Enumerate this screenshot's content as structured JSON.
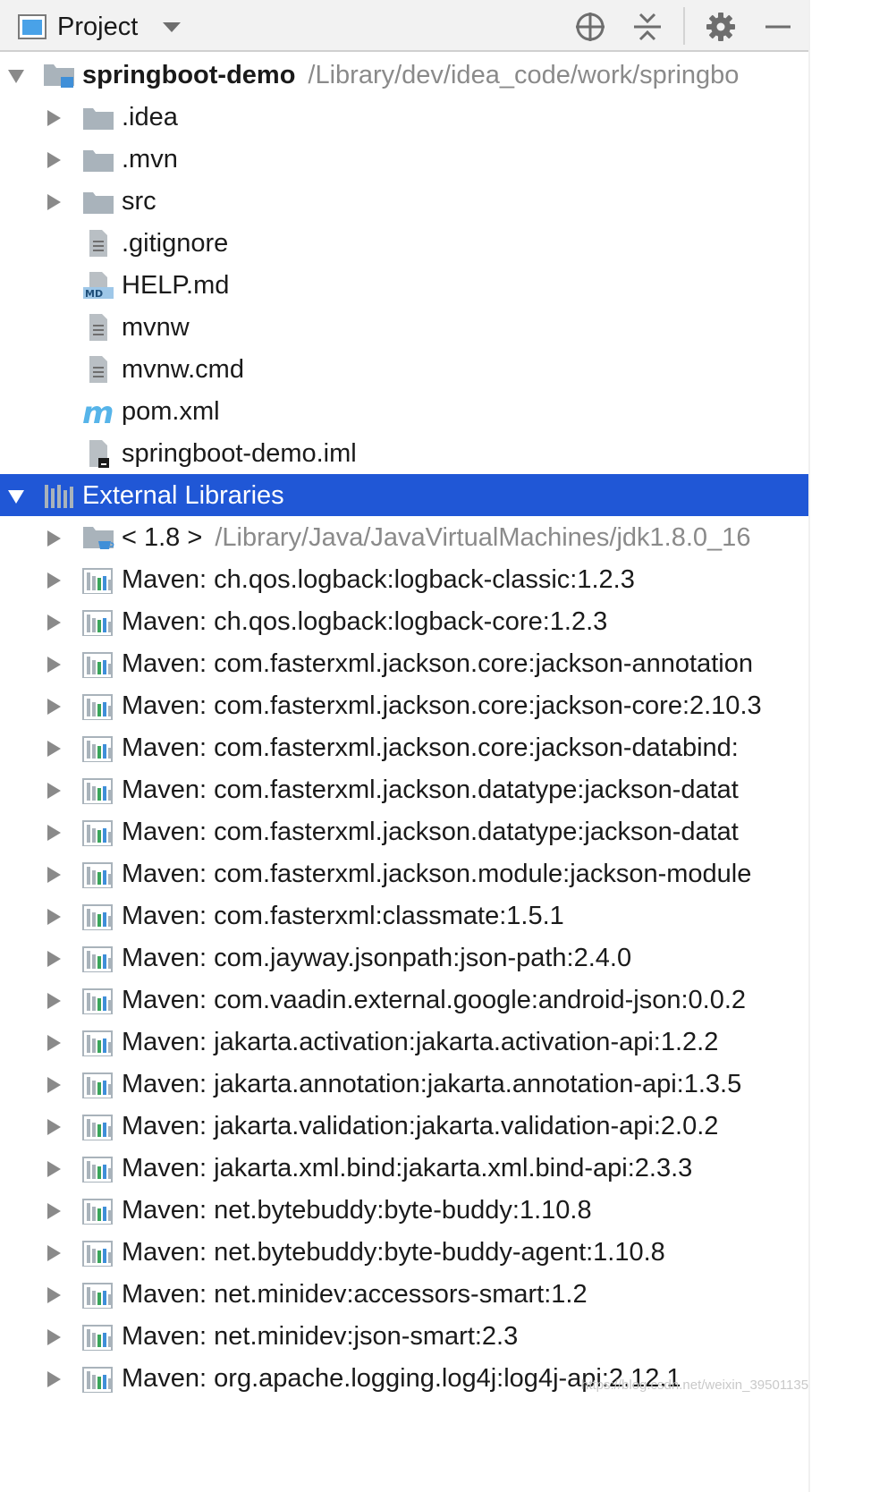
{
  "toolbar": {
    "title": "Project",
    "icons": [
      "project-view-icon",
      "dropdown-caret-icon",
      "locate-icon",
      "collapse-all-icon",
      "gear-icon",
      "minimize-icon"
    ]
  },
  "tree": [
    {
      "label": "springboot-demo",
      "path": "/Library/dev/idea_code/work/springbo",
      "icon": "module-folder-icon",
      "arrow": "expanded",
      "bold": true,
      "level": 0
    },
    {
      "label": ".idea",
      "icon": "folder-icon",
      "arrow": "collapsed",
      "level": 1
    },
    {
      "label": ".mvn",
      "icon": "folder-icon",
      "arrow": "collapsed",
      "level": 1
    },
    {
      "label": "src",
      "icon": "folder-icon",
      "arrow": "collapsed",
      "level": 1
    },
    {
      "label": ".gitignore",
      "icon": "text-file-icon",
      "arrow": "none",
      "level": 1
    },
    {
      "label": "HELP.md",
      "icon": "markdown-file-icon",
      "arrow": "none",
      "level": 1
    },
    {
      "label": "mvnw",
      "icon": "text-file-icon",
      "arrow": "none",
      "level": 1
    },
    {
      "label": "mvnw.cmd",
      "icon": "text-file-icon",
      "arrow": "none",
      "level": 1
    },
    {
      "label": "pom.xml",
      "icon": "maven-icon",
      "arrow": "none",
      "level": 1
    },
    {
      "label": "springboot-demo.iml",
      "icon": "iml-file-icon",
      "arrow": "none",
      "level": 1
    },
    {
      "label": "External Libraries",
      "icon": "external-libraries-icon",
      "arrow": "expanded",
      "level": 0,
      "selected": true
    },
    {
      "label": "< 1.8 >",
      "path": "/Library/Java/JavaVirtualMachines/jdk1.8.0_16",
      "icon": "jdk-icon",
      "arrow": "collapsed",
      "level": 1
    },
    {
      "label": "Maven: ch.qos.logback:logback-classic:1.2.3",
      "icon": "library-icon",
      "arrow": "collapsed",
      "level": 1
    },
    {
      "label": "Maven: ch.qos.logback:logback-core:1.2.3",
      "icon": "library-icon",
      "arrow": "collapsed",
      "level": 1
    },
    {
      "label": "Maven: com.fasterxml.jackson.core:jackson-annotation",
      "icon": "library-icon",
      "arrow": "collapsed",
      "level": 1
    },
    {
      "label": "Maven: com.fasterxml.jackson.core:jackson-core:2.10.3",
      "icon": "library-icon",
      "arrow": "collapsed",
      "level": 1
    },
    {
      "label": "Maven: com.fasterxml.jackson.core:jackson-databind:",
      "icon": "library-icon",
      "arrow": "collapsed",
      "level": 1
    },
    {
      "label": "Maven: com.fasterxml.jackson.datatype:jackson-datat",
      "icon": "library-icon",
      "arrow": "collapsed",
      "level": 1
    },
    {
      "label": "Maven: com.fasterxml.jackson.datatype:jackson-datat",
      "icon": "library-icon",
      "arrow": "collapsed",
      "level": 1
    },
    {
      "label": "Maven: com.fasterxml.jackson.module:jackson-module",
      "icon": "library-icon",
      "arrow": "collapsed",
      "level": 1
    },
    {
      "label": "Maven: com.fasterxml:classmate:1.5.1",
      "icon": "library-icon",
      "arrow": "collapsed",
      "level": 1
    },
    {
      "label": "Maven: com.jayway.jsonpath:json-path:2.4.0",
      "icon": "library-icon",
      "arrow": "collapsed",
      "level": 1
    },
    {
      "label": "Maven: com.vaadin.external.google:android-json:0.0.2",
      "icon": "library-icon",
      "arrow": "collapsed",
      "level": 1
    },
    {
      "label": "Maven: jakarta.activation:jakarta.activation-api:1.2.2",
      "icon": "library-icon",
      "arrow": "collapsed",
      "level": 1
    },
    {
      "label": "Maven: jakarta.annotation:jakarta.annotation-api:1.3.5",
      "icon": "library-icon",
      "arrow": "collapsed",
      "level": 1
    },
    {
      "label": "Maven: jakarta.validation:jakarta.validation-api:2.0.2",
      "icon": "library-icon",
      "arrow": "collapsed",
      "level": 1
    },
    {
      "label": "Maven: jakarta.xml.bind:jakarta.xml.bind-api:2.3.3",
      "icon": "library-icon",
      "arrow": "collapsed",
      "level": 1
    },
    {
      "label": "Maven: net.bytebuddy:byte-buddy:1.10.8",
      "icon": "library-icon",
      "arrow": "collapsed",
      "level": 1
    },
    {
      "label": "Maven: net.bytebuddy:byte-buddy-agent:1.10.8",
      "icon": "library-icon",
      "arrow": "collapsed",
      "level": 1
    },
    {
      "label": "Maven: net.minidev:accessors-smart:1.2",
      "icon": "library-icon",
      "arrow": "collapsed",
      "level": 1
    },
    {
      "label": "Maven: net.minidev:json-smart:2.3",
      "icon": "library-icon",
      "arrow": "collapsed",
      "level": 1
    },
    {
      "label": "Maven: org.apache.logging.log4j:log4j-api:2.12.1",
      "icon": "library-icon",
      "arrow": "collapsed",
      "level": 1
    }
  ],
  "watermark": "https://blog.csdn.net/weixin_39501135",
  "colors": {
    "selection": "#2057d6",
    "folder": "#a9b3bb",
    "path_text": "#8a8a8a",
    "maven": "#56b4e9"
  }
}
